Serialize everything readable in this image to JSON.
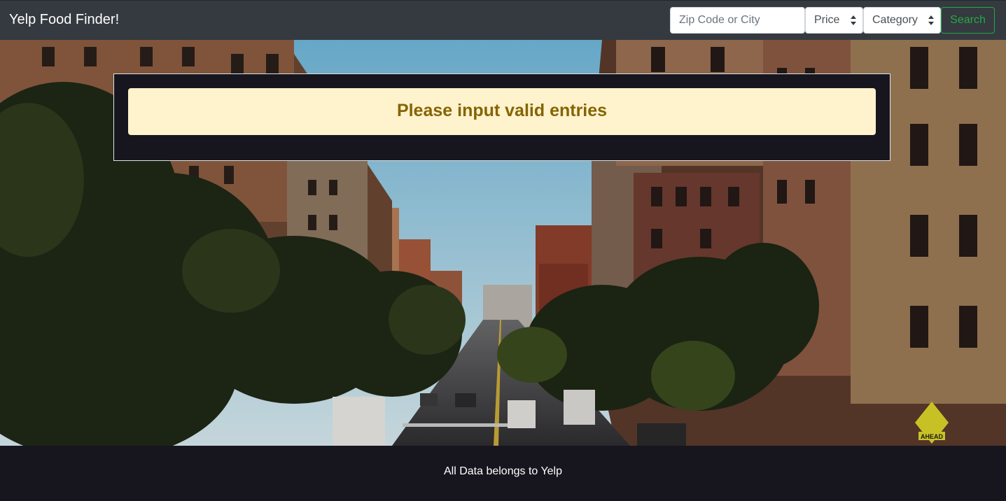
{
  "navbar": {
    "brand": "Yelp Food Finder!",
    "search": {
      "placeholder": "Zip Code or City",
      "value": "",
      "price_label": "Price",
      "category_label": "Category",
      "submit_label": "Search"
    }
  },
  "alert": {
    "message": "Please input valid entries"
  },
  "hero": {
    "sign_text": "AHEAD"
  },
  "footer": {
    "text": "All Data belongs to Yelp"
  },
  "colors": {
    "navbar_bg": "#343a40",
    "page_bg": "#17161f",
    "search_button": "#28a745",
    "alert_bg": "#fff3cd",
    "alert_text": "#856404"
  }
}
